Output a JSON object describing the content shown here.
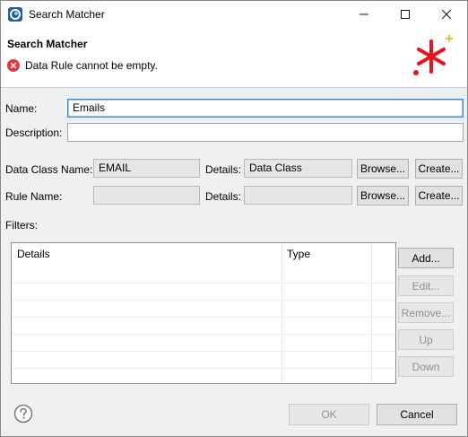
{
  "window": {
    "title": "Search Matcher"
  },
  "header": {
    "title": "Search Matcher",
    "error_message": "Data Rule cannot be empty."
  },
  "form": {
    "name_label": "Name:",
    "name_value": "Emails",
    "description_label": "Description:",
    "description_value": "",
    "data_class_label": "Data Class Name:",
    "data_class_value": "EMAIL",
    "data_class_details_label": "Details:",
    "data_class_details_value": "Data Class",
    "rule_label": "Rule Name:",
    "rule_value": "",
    "rule_details_label": "Details:",
    "rule_details_value": "",
    "browse_label": "Browse...",
    "create_label": "Create..."
  },
  "filters": {
    "label": "Filters:",
    "columns": [
      "Details",
      "Type"
    ],
    "rows": [],
    "buttons": {
      "add": "Add...",
      "edit": "Edit...",
      "remove": "Remove...",
      "up": "Up",
      "down": "Down"
    }
  },
  "footer": {
    "ok": "OK",
    "cancel": "Cancel"
  },
  "icons": {
    "app": "app-logo-icon",
    "error": "error-icon",
    "banner": "asterisk-wizard-icon",
    "help": "help-icon"
  },
  "colors": {
    "error_red": "#e0393e",
    "banner_red": "#e8141c",
    "sparkle": "#d9b500",
    "focus_border": "#3f88c5"
  }
}
